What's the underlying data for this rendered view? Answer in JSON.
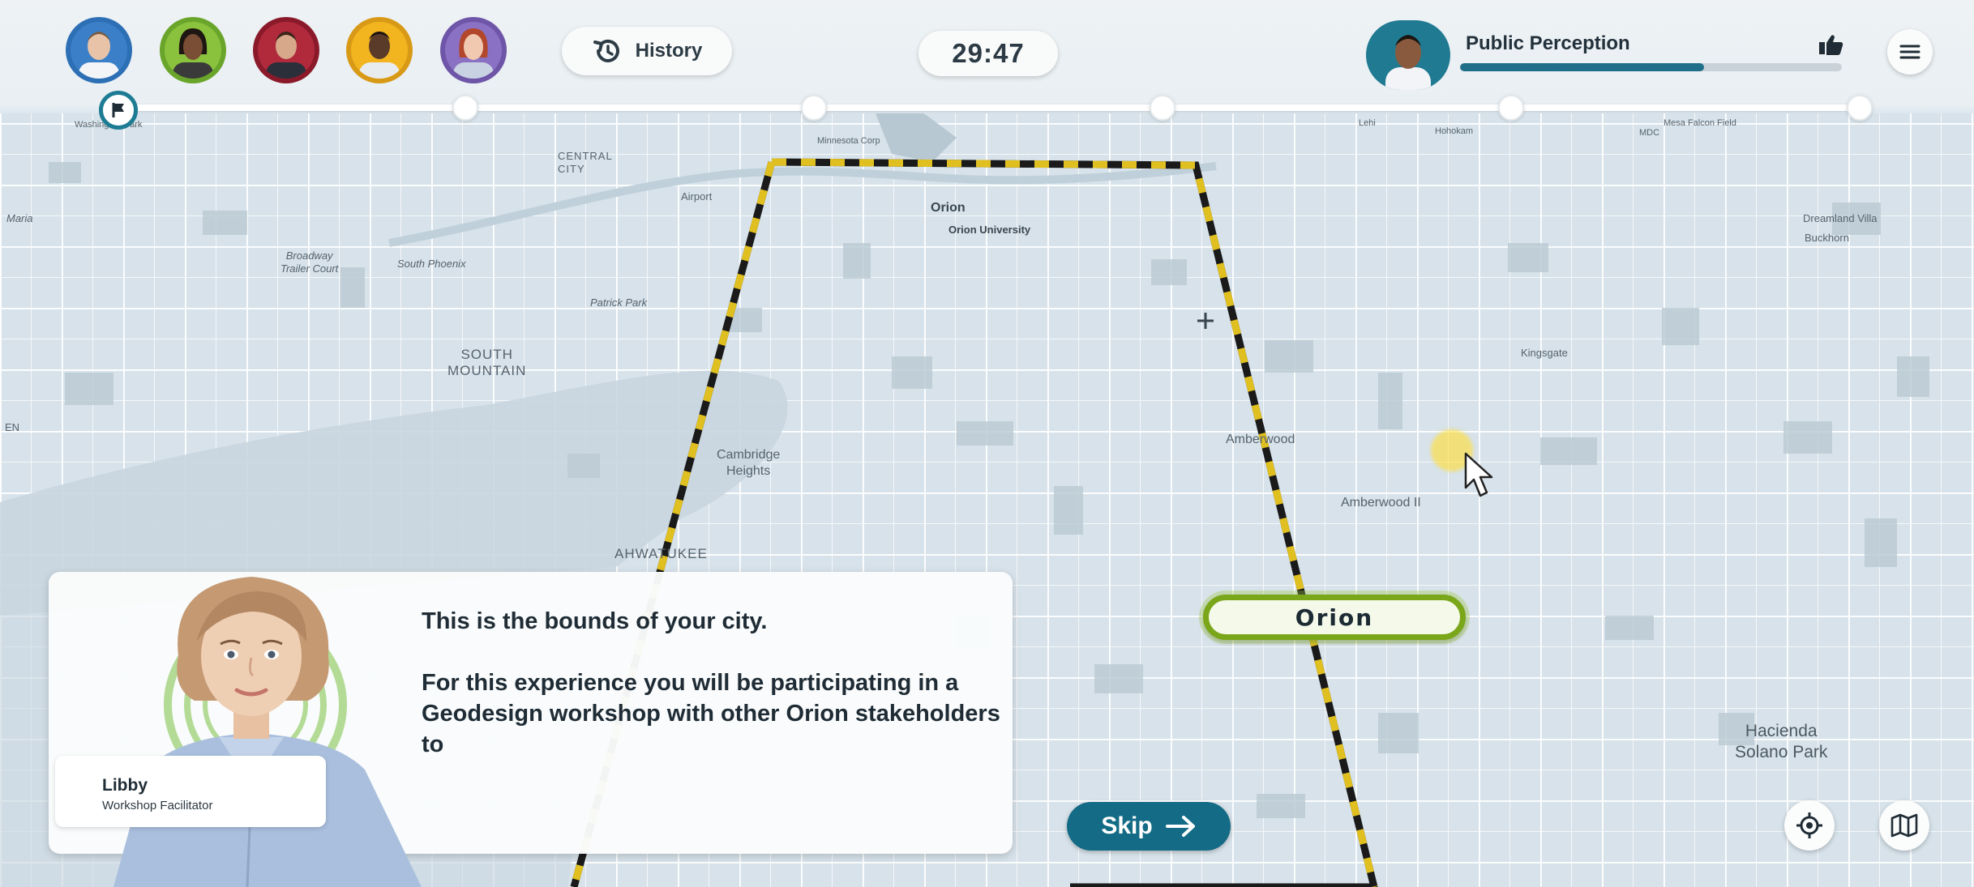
{
  "participants": [
    {
      "name": "participant-1",
      "ring": "#2d6fb5",
      "bg": "#3a7fc8",
      "skin": "#e8c3a8",
      "hair": "#7a5a3e"
    },
    {
      "name": "participant-2",
      "ring": "#6aa52b",
      "bg": "#8ac23e",
      "skin": "#7a4e35",
      "hair": "#1e1612"
    },
    {
      "name": "participant-3",
      "ring": "#8a1a2a",
      "bg": "#b02a3c",
      "skin": "#d8a88a",
      "hair": "#3a2518"
    },
    {
      "name": "participant-4",
      "ring": "#d89a16",
      "bg": "#f2b51f",
      "skin": "#5a3a28",
      "hair": "#1b1410"
    },
    {
      "name": "participant-5",
      "ring": "#6e55a8",
      "bg": "#8a71c4",
      "skin": "#f0c9b0",
      "hair": "#b3472b"
    }
  ],
  "history": {
    "label": "History",
    "icon": "history-icon"
  },
  "timer": {
    "value": "29:47"
  },
  "public_perception": {
    "title": "Public Perception",
    "level": 0.64,
    "icon": "thumbs-up-icon"
  },
  "menu": {
    "icon": "hamburger-menu-icon"
  },
  "map_labels": {
    "central_city": "CENTRAL\nCITY",
    "airport": "Airport",
    "orion": "Orion",
    "orion_university": "Orion University",
    "broadway": "Broadway\nTrailer Court",
    "south_phoenix": "South Phoenix",
    "patrick_park": "Patrick Park",
    "south_mountain": "SOUTH\nMOUNTAIN",
    "cambridge_heights": "Cambridge\nHeights",
    "ahwatukee": "AHWATUKEE",
    "amberwood": "Amberwood",
    "amberwood_ii": "Amberwood II",
    "kingsgate": "Kingsgate",
    "hacienda": "Hacienda\nSolano Park",
    "dreamland": "Dreamland Villa",
    "buckhorn": "Buckhorn",
    "maria": "Maria",
    "en": "EN",
    "minnesota": "Minnesota Corp",
    "lehi": "Lehi",
    "hohokam": "Hohokam",
    "washington": "Washington Park",
    "mesa_falcon": "Mesa Falcon Field",
    "mdc": "MDC"
  },
  "city_marker": {
    "label": "Orion"
  },
  "dialog": {
    "line1": "This is the bounds of your city.",
    "line2": "For this experience you will be participating in a Geodesign workshop with other Orion stakeholders to",
    "speaker_name": "Libby",
    "speaker_role": "Workshop Facilitator"
  },
  "skip": {
    "label": "Skip",
    "icon": "arrow-right-icon"
  },
  "controls": {
    "locate_icon": "locate-icon",
    "map_icon": "map-icon"
  },
  "colors": {
    "accent": "#136b86",
    "pill_green": "#7aa61a",
    "boundary_yellow": "#d9b41a"
  }
}
